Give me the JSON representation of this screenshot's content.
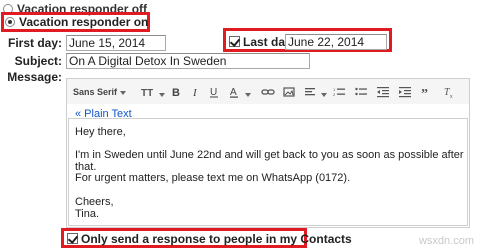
{
  "responder": {
    "off_label": "Vacation responder off",
    "on_label": "Vacation responder on"
  },
  "fields": {
    "first_day_label": "First day:",
    "first_day_value": "June 15, 2014",
    "last_day_label": "Last day:",
    "last_day_value": "June 22, 2014",
    "subject_label": "Subject:",
    "subject_value": "On A Digital Detox In Sweden",
    "message_label": "Message:"
  },
  "toolbar": {
    "font_label": "Sans Serif",
    "size_icon": "text-size-icon",
    "bold_icon": "bold-icon",
    "italic_icon": "italic-icon",
    "underline_icon": "underline-icon",
    "text_color_icon": "text-color-icon",
    "link_icon": "link-icon",
    "image_icon": "image-icon",
    "align_icon": "align-icon",
    "numbered_list_icon": "numbered-list-icon",
    "bulleted_list_icon": "bulleted-list-icon",
    "indent_less_icon": "indent-less-icon",
    "indent_more_icon": "indent-more-icon",
    "quote_icon": "quote-icon",
    "clear_format_icon": "remove-formatting-icon"
  },
  "editor": {
    "plain_text_link": "« Plain Text",
    "lines": [
      "Hey there,",
      "I'm in Sweden until June 22nd and will get back to you as soon as possible after that.",
      "For urgent matters, please text me on WhatsApp (0172).",
      "Cheers,",
      "Tina."
    ]
  },
  "contacts_option": {
    "label": "Only send a response to people in my Contacts",
    "checked": true
  },
  "last_day_checked": true,
  "watermark": "wsxdn.com",
  "colors": {
    "highlight_red": "#e11b22",
    "link_blue": "#15c"
  }
}
